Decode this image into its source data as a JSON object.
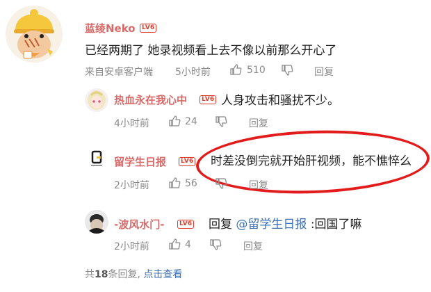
{
  "main_comment": {
    "username": "蓝绫Neko",
    "level": "LV6",
    "text": "已经两期了 她录视频看上去不像以前那么开心了",
    "source": "来自安卓客户端",
    "time": "5小时前",
    "likes": "510",
    "reply_label": "回复"
  },
  "replies": [
    {
      "username": "热血永在我心中",
      "level": "LV6",
      "text": "人身攻击和骚扰不少。",
      "time": "4小时前",
      "likes": "24",
      "reply_label": "回复"
    },
    {
      "username": "留学生日报",
      "level": "LV6",
      "text": "时差没倒完就开始肝视频，能不憔悴么",
      "time": "2小时前",
      "likes": "56",
      "reply_label": "回复"
    },
    {
      "username": "-波风水门-",
      "level": "LV6",
      "reply_prefix": "回复",
      "mention": "@留学生日报",
      "text": ":回国了嘛",
      "time": "2小时前",
      "likes": "4",
      "reply_label": "回复"
    }
  ],
  "footer": {
    "count_prefix": "共",
    "count": "18",
    "count_suffix": "条回复,",
    "view_link": "点击查看"
  },
  "colors": {
    "username": "#d96a6a",
    "level_badge": "#e03a2a",
    "link": "#3b6fb6",
    "meta": "#8a8a8a",
    "highlight": "#e21b1b"
  },
  "icons": [
    "thumbs-up-icon",
    "thumbs-down-icon"
  ]
}
